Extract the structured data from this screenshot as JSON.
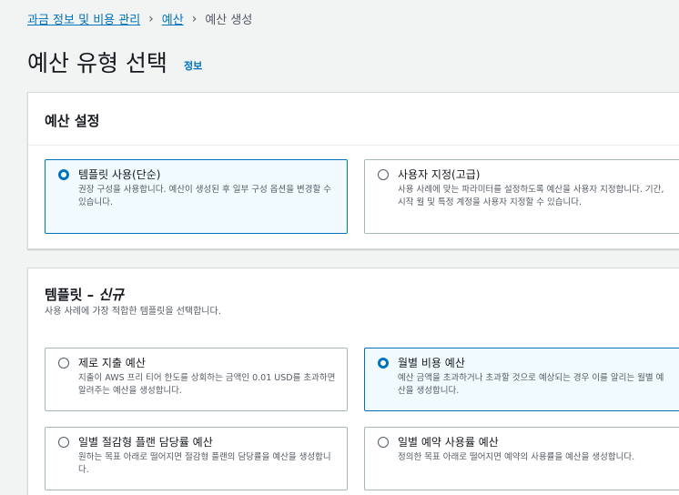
{
  "breadcrumb": {
    "items": [
      "과금 정보 및 비용 관리",
      "예산"
    ],
    "separator": "›",
    "current": "예산 생성"
  },
  "page": {
    "title": "예산 유형 선택",
    "info_link": "정보"
  },
  "budget_setup": {
    "title": "예산 설정",
    "options": [
      {
        "label": "템플릿 사용(단순)",
        "description": "권장 구성을 사용합니다. 예산이 생성된 후 일부 구성 옵션을 변경할 수 있습니다.",
        "selected": true
      },
      {
        "label": "사용자 지정(고급)",
        "description": "사용 사례에 맞는 파라미터를 설정하도록 예산을 사용자 지정합니다. 기간, 시작 월 및 특정 계정을 사용자 지정할 수 있습니다.",
        "selected": false
      }
    ]
  },
  "templates": {
    "title": "템플릿 –",
    "title_new": "신규",
    "description": "사용 사례에 가장 적합한 템플릿을 선택합니다.",
    "options": [
      {
        "label": "제로 지출 예산",
        "description": "지출이 AWS 프리 티어 한도를 상회하는 금액인 0.01 USD를 초과하면 알려주는 예산을 생성합니다.",
        "selected": false
      },
      {
        "label": "월별 비용 예산",
        "description": "예산 금액을 초과하거나 초과할 것으로 예상되는 경우 이를 알리는 월별 예산을 생성합니다.",
        "selected": true
      },
      {
        "label": "일별 절감형 플랜 담당률 예산",
        "description": "원하는 목표 아래로 떨어지면 절감형 플랜의 담당률을 예산을 생성합니다.",
        "selected": false
      },
      {
        "label": "일별 예약 사용률 예산",
        "description": "정의한 목표 아래로 떨어지면 예약의 사용률을 예산을 생성합니다.",
        "selected": false
      }
    ]
  },
  "colors": {
    "link": "#0073bb",
    "selected_border": "#0073bb",
    "selected_bg": "#f1faff",
    "page_bg": "#f2f3f3"
  }
}
